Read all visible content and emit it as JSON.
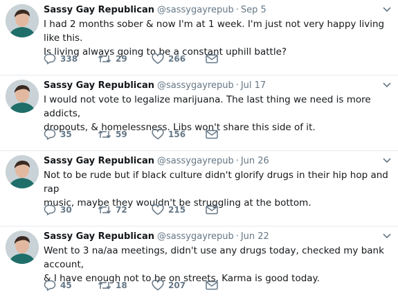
{
  "colors": {
    "text": "#14171a",
    "secondary": "#657786",
    "divider": "#e6ecf0"
  },
  "icons": {
    "reply": "reply-icon",
    "retweet": "retweet-icon",
    "like": "heart-icon",
    "message": "envelope-icon",
    "menu": "chevron-down-icon"
  },
  "tweets": [
    {
      "name": "Sassy Gay Republican",
      "handle": "@sassygayrepub",
      "separator": "·",
      "date": "Sep 5",
      "text": "I had 2 months sober & now I'm at 1 week. I'm just not very happy living like this.\nIs living always going to be a constant uphill battle?",
      "replies": "338",
      "retweets": "29",
      "likes": "266"
    },
    {
      "name": "Sassy Gay Republican",
      "handle": "@sassygayrepub",
      "separator": "·",
      "date": "Jul 17",
      "text": "I would not vote to legalize marijuana. The last thing we need is more addicts,\ndropouts, & homelessness. Libs won't share this side of it.",
      "replies": "35",
      "retweets": "59",
      "likes": "156"
    },
    {
      "name": "Sassy Gay Republican",
      "handle": "@sassygayrepub",
      "separator": "·",
      "date": "Jun 26",
      "text": "Not to be rude but if black culture didn't glorify drugs in their hip hop and rap\nmusic, maybe they wouldn't be struggling at the bottom.",
      "replies": "30",
      "retweets": "72",
      "likes": "215"
    },
    {
      "name": "Sassy Gay Republican",
      "handle": "@sassygayrepub",
      "separator": "·",
      "date": "Jun 22",
      "text": "Went to 3 na/aa meetings, didn't use any drugs today, checked my bank account,\n& I have enough not to be on streets. Karma is good today.",
      "replies": "45",
      "retweets": "18",
      "likes": "207"
    }
  ]
}
